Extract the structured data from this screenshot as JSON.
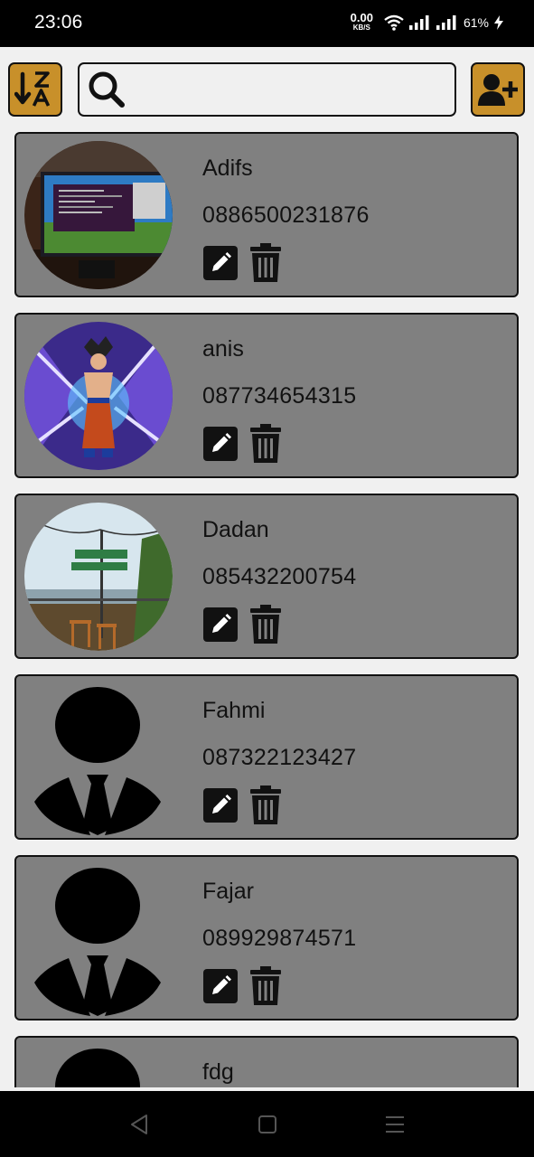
{
  "status_bar": {
    "time": "23:06",
    "net_speed_value": "0.00",
    "net_speed_unit": "KB/S",
    "battery": "61%"
  },
  "toolbar": {
    "sort_icon": "sort-alpha-down-alt-icon",
    "search_placeholder": "",
    "search_value": "",
    "add_icon": "user-plus-icon",
    "accent_color": "#c8902a"
  },
  "contacts": [
    {
      "name": "Adifs",
      "phone": "0886500231876",
      "avatar": "photo-monitor"
    },
    {
      "name": "anis",
      "phone": "087734654315",
      "avatar": "photo-anime-character"
    },
    {
      "name": "Dadan",
      "phone": "085432200754",
      "avatar": "photo-outdoor-viewpoint"
    },
    {
      "name": "Fahmi",
      "phone": "087322123427",
      "avatar": "default-person-icon"
    },
    {
      "name": "Fajar",
      "phone": "089929874571",
      "avatar": "default-person-icon"
    },
    {
      "name": "fdg",
      "phone": "",
      "avatar": "default-person-icon"
    }
  ],
  "card_color": "#808080"
}
